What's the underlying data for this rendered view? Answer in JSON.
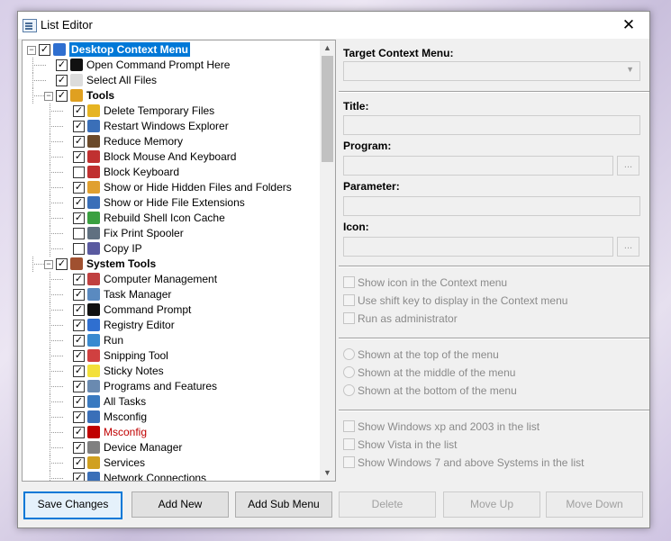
{
  "window": {
    "title": "List Editor",
    "close_glyph": "✕"
  },
  "tree": {
    "items": [
      {
        "label": "Desktop Context Menu",
        "level": 0,
        "expander": "−",
        "checked": true,
        "bold": true,
        "selected": true,
        "icon": "desktop-icon",
        "color": "#2f6fd0"
      },
      {
        "label": "Open Command Prompt Here",
        "level": 1,
        "checked": true,
        "icon": "cmd-icon",
        "color": "#111111"
      },
      {
        "label": "Select All Files",
        "level": 1,
        "checked": true,
        "icon": "file-icon",
        "color": "#dcdcdc"
      },
      {
        "label": "Tools",
        "level": 1,
        "expander": "−",
        "checked": true,
        "bold": true,
        "icon": "tools-icon",
        "color": "#e0a020"
      },
      {
        "label": "Delete Temporary Files",
        "level": 2,
        "checked": true,
        "icon": "broom-icon",
        "color": "#e6b422"
      },
      {
        "label": "Restart Windows Explorer",
        "level": 2,
        "checked": true,
        "icon": "globe-icon",
        "color": "#3a6fb8"
      },
      {
        "label": "Reduce Memory",
        "level": 2,
        "checked": true,
        "icon": "memory-icon",
        "color": "#6b4a2a"
      },
      {
        "label": "Block Mouse And Keyboard",
        "level": 2,
        "checked": true,
        "icon": "keyboard-block-icon",
        "color": "#c03030"
      },
      {
        "label": "Block Keyboard",
        "level": 2,
        "checked": false,
        "icon": "keyboard-icon",
        "color": "#c03030"
      },
      {
        "label": "Show or Hide Hidden Files and Folders",
        "level": 2,
        "checked": true,
        "icon": "folder-icon",
        "color": "#e0a030"
      },
      {
        "label": "Show or Hide File Extensions",
        "level": 2,
        "checked": true,
        "icon": "extension-icon",
        "color": "#3a6fb8"
      },
      {
        "label": "Rebuild Shell Icon Cache",
        "level": 2,
        "checked": true,
        "icon": "refresh-icon",
        "color": "#3aa040"
      },
      {
        "label": "Fix Print Spooler",
        "level": 2,
        "checked": false,
        "icon": "printer-icon",
        "color": "#607080"
      },
      {
        "label": "Copy IP",
        "level": 2,
        "checked": false,
        "icon": "ip-icon",
        "color": "#5a5aa0"
      },
      {
        "label": "System Tools",
        "level": 1,
        "expander": "−",
        "checked": true,
        "bold": true,
        "icon": "system-tools-icon",
        "color": "#a05030"
      },
      {
        "label": "Computer Management",
        "level": 2,
        "checked": true,
        "icon": "computer-management-icon",
        "color": "#c04040"
      },
      {
        "label": "Task Manager",
        "level": 2,
        "checked": true,
        "icon": "task-manager-icon",
        "color": "#5a8ac0"
      },
      {
        "label": "Command Prompt",
        "level": 2,
        "checked": true,
        "icon": "cmd-icon",
        "color": "#111111"
      },
      {
        "label": "Registry Editor",
        "level": 2,
        "checked": true,
        "icon": "registry-icon",
        "color": "#2f6fd0"
      },
      {
        "label": "Run",
        "level": 2,
        "checked": true,
        "icon": "run-icon",
        "color": "#3a8ad0"
      },
      {
        "label": "Snipping Tool",
        "level": 2,
        "checked": true,
        "icon": "scissors-icon",
        "color": "#d04040"
      },
      {
        "label": "Sticky Notes",
        "level": 2,
        "checked": true,
        "icon": "sticky-notes-icon",
        "color": "#f3e03a"
      },
      {
        "label": "Programs and Features",
        "level": 2,
        "checked": true,
        "icon": "programs-icon",
        "color": "#6a8ab0"
      },
      {
        "label": "All Tasks",
        "level": 2,
        "checked": true,
        "icon": "all-tasks-icon",
        "color": "#3a7ac0"
      },
      {
        "label": "Msconfig",
        "level": 2,
        "checked": true,
        "icon": "msconfig-icon",
        "color": "#3a6fb8"
      },
      {
        "label": "Msconfig",
        "level": 2,
        "checked": true,
        "red": true,
        "icon": "x-icon",
        "color": "#c00000"
      },
      {
        "label": "Device Manager",
        "level": 2,
        "checked": true,
        "icon": "device-manager-icon",
        "color": "#808080"
      },
      {
        "label": "Services",
        "level": 2,
        "checked": true,
        "icon": "services-icon",
        "color": "#d0a020"
      },
      {
        "label": "Network Connections",
        "level": 2,
        "checked": true,
        "icon": "network-icon",
        "color": "#3a6fb8"
      }
    ]
  },
  "form": {
    "target_label": "Target Context Menu:",
    "target_value": "",
    "title_label": "Title:",
    "title_value": "",
    "program_label": "Program:",
    "program_value": "",
    "parameter_label": "Parameter:",
    "parameter_value": "",
    "icon_label": "Icon:",
    "icon_value": "",
    "browse_label": "...",
    "options": [
      "Show icon in the Context menu",
      "Use shift key to display in the Context menu",
      "Run as administrator"
    ],
    "positions": [
      "Shown at the top of the menu",
      "Shown at the middle of the menu",
      "Shown at the bottom of the menu"
    ],
    "systems": [
      "Show Windows xp  and 2003 in the list",
      "Show Vista in the list",
      "Show Windows 7 and above Systems in the list"
    ]
  },
  "buttons": {
    "save": "Save Changes",
    "add_new": "Add New",
    "add_sub_menu": "Add Sub Menu",
    "delete": "Delete",
    "move_up": "Move Up",
    "move_down": "Move Down"
  }
}
